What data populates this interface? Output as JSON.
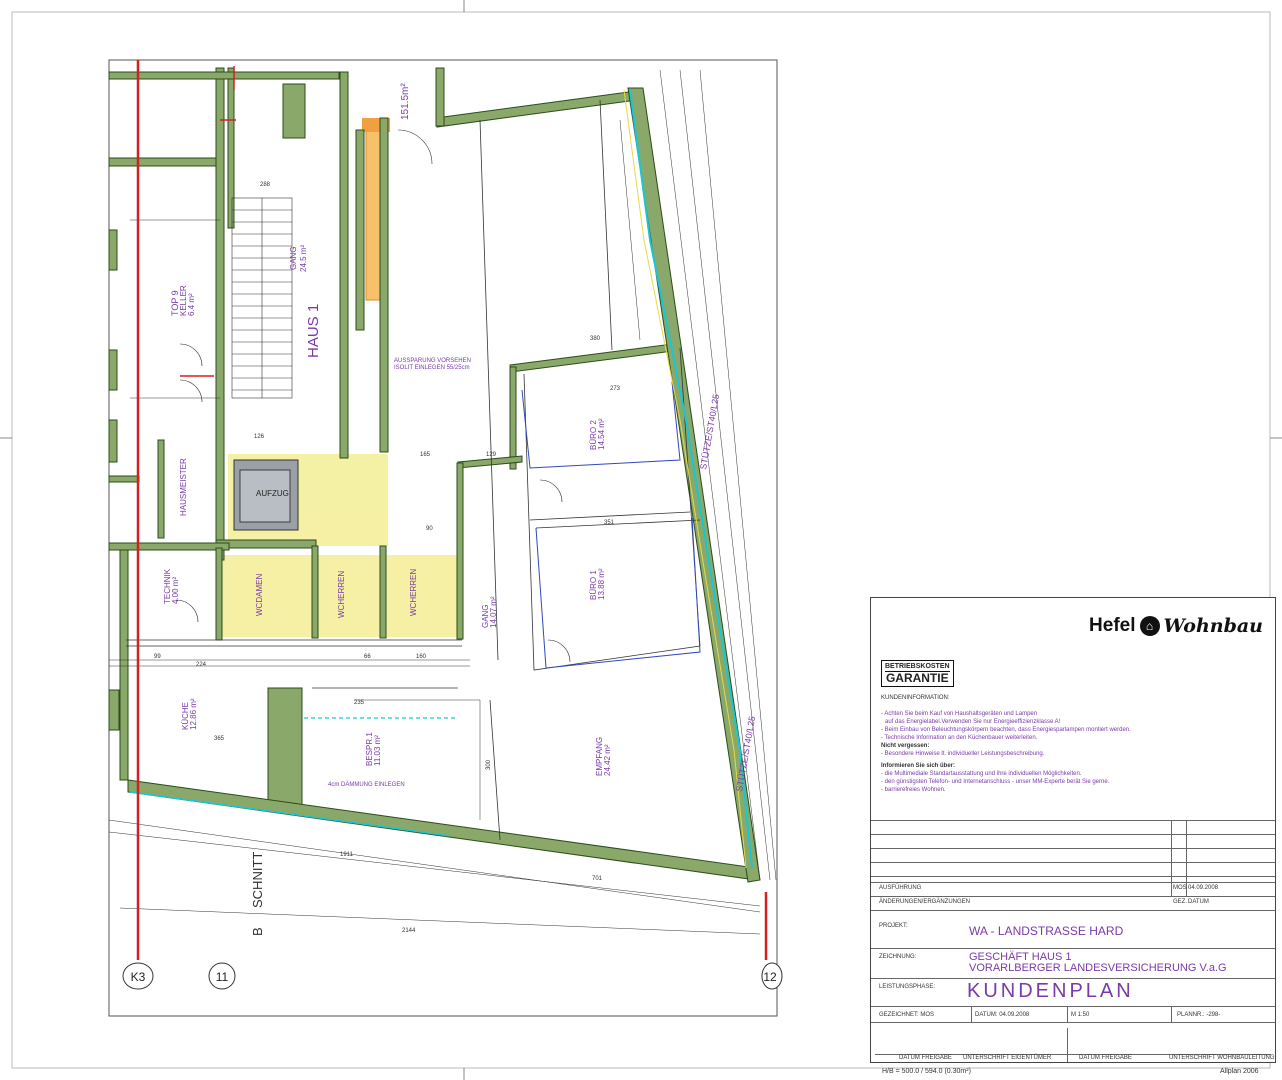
{
  "brand": {
    "name": "Hefel",
    "suffix": "Wohnbau",
    "house_icon": "house-icon"
  },
  "badge": {
    "line1": "BETRIEBSKOSTEN",
    "line2": "GARANTIE"
  },
  "info": {
    "heading": "KUNDENINFORMATION:",
    "lines": [
      "- Achten Sie beim Kauf von Haushaltsgeräten und Lampen",
      "  auf das Energielabel.Verwenden Sie nur Energieeffizienzklasse A!",
      "- Beim Einbau von Beleuchtungskörpern beachten, dass Energiesparlampen montiert werden.",
      "- Technische Information an den Küchenbauer weiterleiten."
    ],
    "nicht_heading": "Nicht vergessen:",
    "nicht_lines": [
      "- Besondere Hinweise lt. individueller Leistungsbeschreibung."
    ],
    "informieren_heading": "Informieren Sie sich über:",
    "informieren_lines": [
      "- die Multimediale Standartausstattung und ihre individuellen Möglichkeiten.",
      "- den günstigsten Telefon- und Internetanschluss - unser MM-Experte berät Sie gerne.",
      "- barrierefreies Wohnen."
    ]
  },
  "titleblock": {
    "ausfuehrung": "AUSFÜHRUNG",
    "aenderungen": "ÄNDERUNGEN/ERGÄNZUNGEN",
    "mos": "MOS",
    "date1": "04.09.2008",
    "gez": "GEZ.",
    "datum_label": "DATUM",
    "projekt_label": "PROJEKT:",
    "projekt": "WA - LANDSTRASSE HARD",
    "zeichnung_label": "ZEICHNUNG:",
    "zeichnung1": "GESCHÄFT HAUS 1",
    "zeichnung2": "VORARLBERGER LANDESVERSICHERUNG V.a.G",
    "phase_label": "LEISTUNGSPHASE:",
    "phase": "KUNDENPLAN",
    "gezeichnet": "GEZEICHNET: MOS",
    "datum": "DATUM: 04.09.2008",
    "massstab": "M 1:50",
    "plannr": "PLANNR.: -298-",
    "freigabe1": "DATUM FREIGABE",
    "unterschrift1": "UNTERSCHRIFT EIGENTÜMER",
    "freigabe2": "DATUM FREIGABE",
    "unterschrift2": "UNTERSCHRIFT WOHNBAULEITUNG",
    "hb": "H/B = 500.0 / 594.0 (0.30m²)",
    "software": "Allplan 2006"
  },
  "axes": {
    "k3": "K3",
    "n11": "11",
    "n12": "12"
  },
  "plan_labels": {
    "haus": "HAUS 1",
    "schnitt": "SCHNITT",
    "schnitt_b": "B",
    "gang_top": "GANG",
    "gang_top_area": "24.5 m²",
    "top9": "TOP 9",
    "top9_sub": "KELLER",
    "top9_area": "6.4 m²",
    "haus_meister": "HAUSMEISTER",
    "technik": "TECHNIK",
    "technik_area": "4.00 m²",
    "wc_damen": "WCDAMEN",
    "wc_herren1": "WCHERREN",
    "wc_herren2": "WCHERREN",
    "aufzug": "AUFZUG",
    "kueche": "KÜCHE",
    "kueche_area": "12.86 m²",
    "bespr": "BESPR.1",
    "bespr_area": "11.03 m²",
    "gang_mid": "GANG",
    "gang_mid_area": "14.07 m²",
    "buero1": "BÜRO 1",
    "buero1_area": "13.88 m²",
    "buero2": "BÜRO 2",
    "buero2_area": "14.54 m²",
    "empfang": "EMPFANG",
    "empfang_area": "24.42 m²",
    "terrasse": "151.5m²",
    "aussparung": "AUSSPARUNG VORSEHEN",
    "isolit": "ISOLIT EINLEGEN 55/25cm",
    "daemmung": "4cm DÄMMUNG EINLEGEN",
    "stuetze1": "STÜTZE/ST40/L25",
    "stuetze2": "STÜTZE/ST40/L25",
    "kuche_d": "KÜCHE",
    "dim_2144": "2144",
    "dim_1911": "1911",
    "dim_701": "701",
    "dim_235": "235",
    "dim_365": "365",
    "dim_351": "351",
    "dim_273": "273",
    "dim_165": "165",
    "dim_129": "129",
    "dim_224": "224",
    "dim_99": "99",
    "dim_160": "160",
    "dim_66": "66",
    "dim_288": "288",
    "dim_126": "126",
    "dim_90": "90",
    "dim_380": "380",
    "dim_300": "300"
  },
  "colors": {
    "wall": "#8aa86a",
    "wall_edge": "#2c4c1a",
    "accent": "#7a3aa8",
    "axis_red": "#d32020",
    "yellow": "#f4ef9a",
    "cyan": "#19c6d3",
    "orange": "#f0a040",
    "blue": "#3048b8"
  }
}
